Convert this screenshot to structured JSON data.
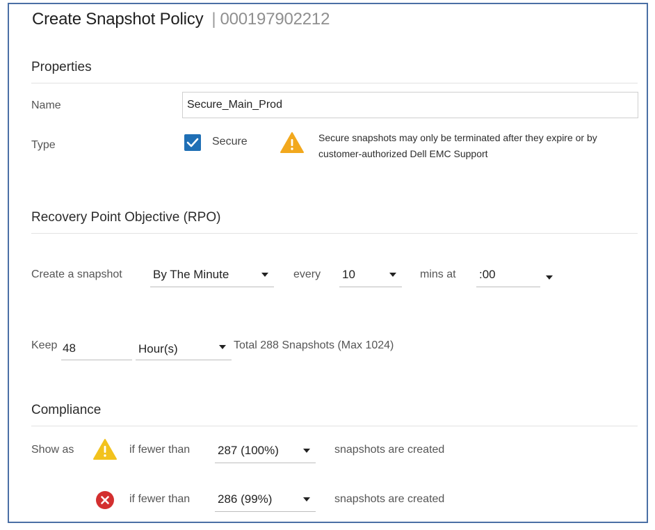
{
  "dialog": {
    "title": "Create Snapshot Policy",
    "separator": "|",
    "array_id": "000197902212"
  },
  "properties": {
    "heading": "Properties",
    "name_label": "Name",
    "name_value": "Secure_Main_Prod",
    "type_label": "Type",
    "secure_checked": true,
    "secure_label": "Secure",
    "secure_warning": "Secure snapshots may only be terminated after they expire or by customer-authorized Dell EMC Support"
  },
  "rpo": {
    "heading": "Recovery Point Objective (RPO)",
    "create_label": "Create a snapshot",
    "frequency": "By The Minute",
    "every_label": "every",
    "interval": "10",
    "mins_at_label": "mins at",
    "offset": ":00",
    "keep_label": "Keep",
    "keep_value": "48",
    "keep_unit": "Hour(s)",
    "total_text": "Total 288 Snapshots (Max 1024)"
  },
  "compliance": {
    "heading": "Compliance",
    "show_as_label": "Show as",
    "warning": {
      "icon": "warning-triangle-icon",
      "if_label": "if fewer than",
      "threshold": "287 (100%)",
      "suffix": "snapshots are created"
    },
    "critical": {
      "icon": "error-circle-icon",
      "if_label": "if fewer than",
      "threshold": "286 (99%)",
      "suffix": "snapshots are created"
    }
  },
  "colors": {
    "accent": "#1f6fb5",
    "warning": "#f2a81d",
    "error": "#d32f2f",
    "frame_border": "#4a6fa5"
  }
}
